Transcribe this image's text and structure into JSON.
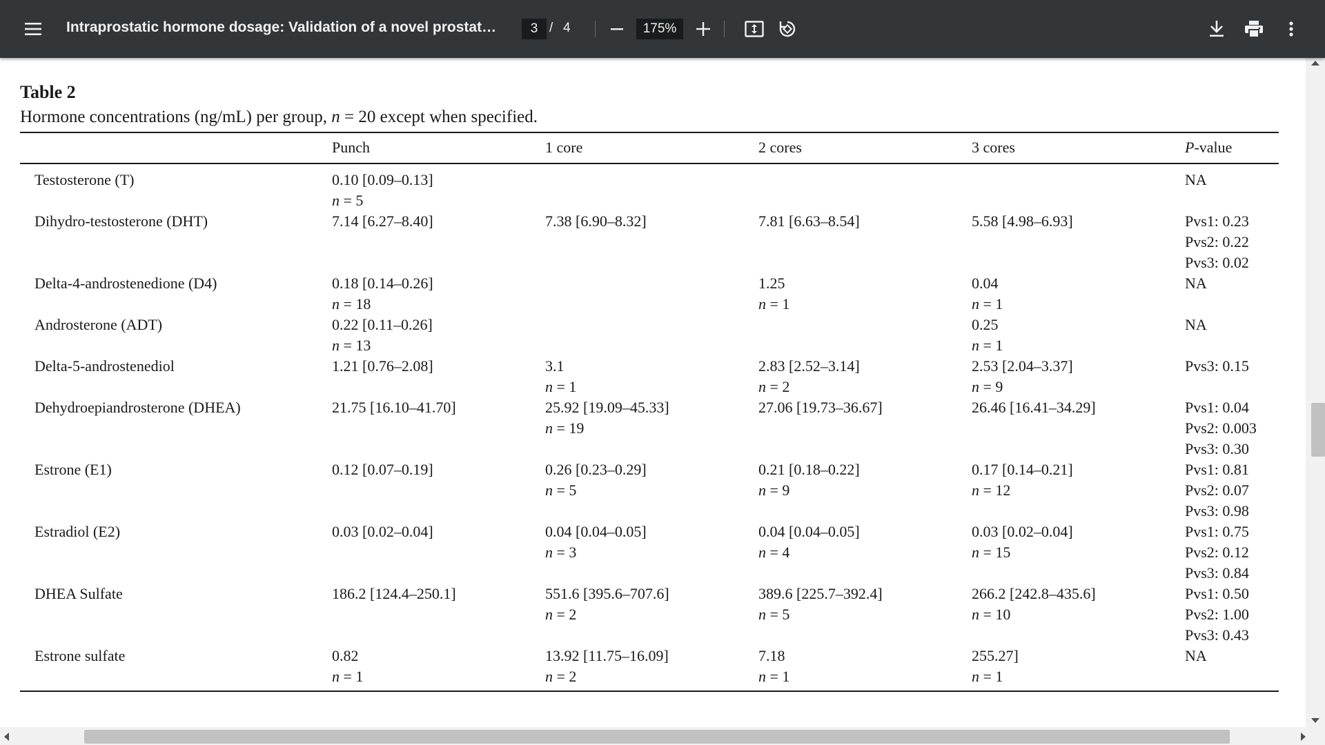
{
  "toolbar": {
    "menu_icon": "hamburger-menu-icon",
    "title": "Intraprostatic hormone dosage: Validation of a novel prostate bi...",
    "current_page": "3",
    "page_separator": "/",
    "total_pages": "4",
    "zoom": "175%",
    "icons": [
      "minus-icon",
      "plus-icon",
      "fit-page-icon",
      "rotate-icon",
      "download-icon",
      "print-icon",
      "more-vert-icon"
    ]
  },
  "document": {
    "table_title": "Table 2",
    "caption_pre": "Hormone concentrations (ng/mL) per group, ",
    "caption_n": "n",
    "caption_post": " = 20 except when specified.",
    "headers": {
      "col0": "",
      "col1": "Punch",
      "col2": "1 core",
      "col3": "2 cores",
      "col4": "3 cores",
      "col5_p": "P",
      "col5_rest": "-value"
    },
    "rows": [
      {
        "name": "Testosterone (T)",
        "punch": [
          "0.10 [0.09–0.13]",
          "n = 5"
        ],
        "core1": [],
        "core2": [],
        "core3": [],
        "p": [
          "NA"
        ]
      },
      {
        "name": "Dihydro-testosterone (DHT)",
        "punch": [
          "7.14 [6.27–8.40]"
        ],
        "core1": [
          "7.38 [6.90–8.32]"
        ],
        "core2": [
          "7.81 [6.63–8.54]"
        ],
        "core3": [
          "5.58 [4.98–6.93]"
        ],
        "p": [
          "Pvs1: 0.23",
          "Pvs2: 0.22",
          "Pvs3: 0.02"
        ]
      },
      {
        "name": "Delta-4-androstenedione (D4)",
        "punch": [
          "0.18 [0.14–0.26]",
          "n = 18"
        ],
        "core1": [],
        "core2": [
          "1.25",
          "n = 1"
        ],
        "core3": [
          "0.04",
          "n = 1"
        ],
        "p": [
          "NA"
        ]
      },
      {
        "name": "Androsterone (ADT)",
        "punch": [
          "0.22 [0.11–0.26]",
          "n = 13"
        ],
        "core1": [],
        "core2": [],
        "core3": [
          "0.25",
          "n = 1"
        ],
        "p": [
          "NA"
        ]
      },
      {
        "name": "Delta-5-androstenediol",
        "punch": [
          "1.21 [0.76–2.08]"
        ],
        "core1": [
          "3.1",
          "n = 1"
        ],
        "core2": [
          "2.83 [2.52–3.14]",
          "n = 2"
        ],
        "core3": [
          "2.53 [2.04–3.37]",
          "n = 9"
        ],
        "p": [
          "Pvs3: 0.15"
        ]
      },
      {
        "name": "Dehydroepiandrosterone (DHEA)",
        "punch": [
          "21.75 [16.10–41.70]"
        ],
        "core1": [
          "25.92 [19.09–45.33]",
          "n = 19"
        ],
        "core2": [
          "27.06 [19.73–36.67]"
        ],
        "core3": [
          "26.46 [16.41–34.29]"
        ],
        "p": [
          "Pvs1: 0.04",
          "Pvs2: 0.003",
          "Pvs3: 0.30"
        ]
      },
      {
        "name": "Estrone (E1)",
        "punch": [
          "0.12 [0.07–0.19]"
        ],
        "core1": [
          "0.26 [0.23–0.29]",
          "n = 5"
        ],
        "core2": [
          "0.21 [0.18–0.22]",
          "n = 9"
        ],
        "core3": [
          "0.17 [0.14–0.21]",
          "n = 12"
        ],
        "p": [
          "Pvs1: 0.81",
          "Pvs2: 0.07",
          "Pvs3: 0.98"
        ]
      },
      {
        "name": "Estradiol (E2)",
        "punch": [
          "0.03 [0.02–0.04]"
        ],
        "core1": [
          "0.04 [0.04–0.05]",
          "n = 3"
        ],
        "core2": [
          "0.04 [0.04–0.05]",
          "n = 4"
        ],
        "core3": [
          "0.03 [0.02–0.04]",
          "n = 15"
        ],
        "p": [
          "Pvs1: 0.75",
          "Pvs2: 0.12",
          "Pvs3: 0.84"
        ]
      },
      {
        "name": "DHEA Sulfate",
        "punch": [
          "186.2 [124.4–250.1]"
        ],
        "core1": [
          "551.6 [395.6–707.6]",
          "n = 2"
        ],
        "core2": [
          "389.6 [225.7–392.4]",
          "n = 5"
        ],
        "core3": [
          "266.2 [242.8–435.6]",
          "n = 10"
        ],
        "p": [
          "Pvs1: 0.50",
          "Pvs2: 1.00",
          "Pvs3: 0.43"
        ]
      },
      {
        "name": "Estrone sulfate",
        "punch": [
          "0.82",
          "n = 1"
        ],
        "core1": [
          "13.92 [11.75–16.09]",
          "n = 2"
        ],
        "core2": [
          "7.18",
          "n = 1"
        ],
        "core3": [
          "255.27]",
          "n = 1"
        ],
        "p": [
          "NA"
        ]
      }
    ]
  }
}
